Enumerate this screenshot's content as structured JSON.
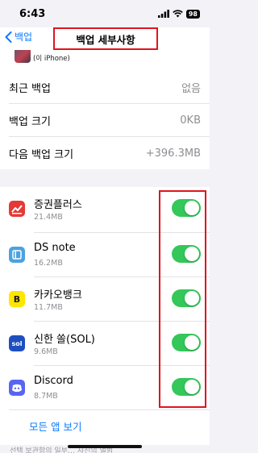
{
  "status": {
    "time": "6:43",
    "battery": "98"
  },
  "nav": {
    "back_label": "백업",
    "title": "백업 세부사항"
  },
  "device": {
    "label": "(이 iPhone)"
  },
  "info": {
    "last_backup_label": "최근 백업",
    "last_backup_value": "없음",
    "backup_size_label": "백업 크기",
    "backup_size_value": "0KB",
    "next_backup_label": "다음 백업 크기",
    "next_backup_value": "+396.3MB"
  },
  "apps": [
    {
      "name": "증권플러스",
      "size": "21.4MB",
      "enabled": true,
      "icon": "chart-icon",
      "color": "#e53935"
    },
    {
      "name": "DS note",
      "size": "16.2MB",
      "enabled": true,
      "icon": "note-icon",
      "color": "#4aa3df"
    },
    {
      "name": "카카오뱅크",
      "size": "11.7MB",
      "enabled": true,
      "icon": "kakaobank-icon",
      "color": "#ffe600"
    },
    {
      "name": "신한 쏠(SOL)",
      "size": "9.6MB",
      "enabled": true,
      "icon": "sol-icon",
      "color": "#1e4fbf"
    },
    {
      "name": "Discord",
      "size": "8.7MB",
      "enabled": true,
      "icon": "discord-icon",
      "color": "#5865f2"
    }
  ],
  "show_all_label": "모든 앱 보기",
  "footer_text": "선택 보관함의 일부… 사진의 앨범"
}
